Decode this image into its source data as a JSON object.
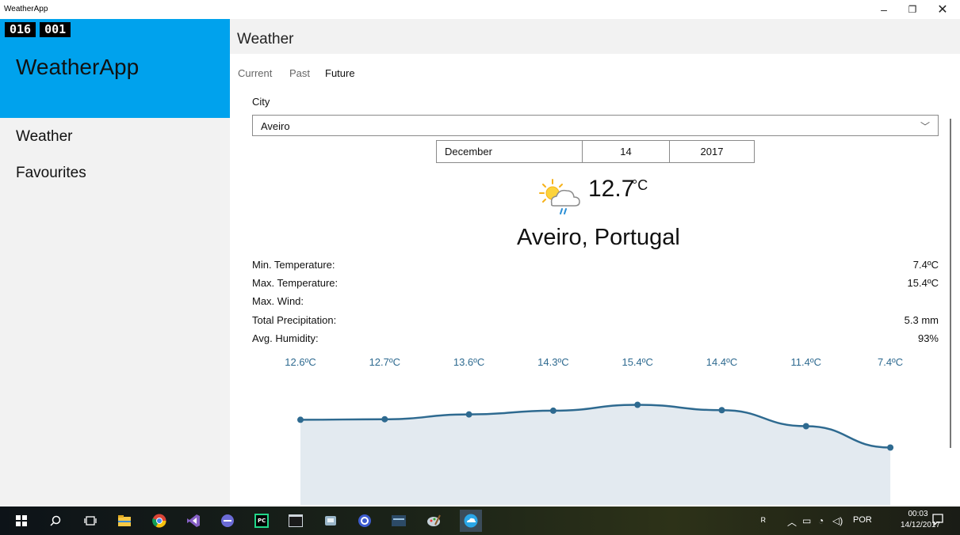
{
  "window": {
    "title": "WeatherApp"
  },
  "pane": {
    "counter": [
      "016",
      "001"
    ],
    "app_name": "WeatherApp",
    "nav": [
      "Weather",
      "Favourites"
    ]
  },
  "main": {
    "title": "Weather",
    "tabs": [
      {
        "label": "Current",
        "selected": false
      },
      {
        "label": "Past",
        "selected": false
      },
      {
        "label": "Future",
        "selected": true
      }
    ],
    "city_label": "City",
    "city_value": "Aveiro",
    "date": {
      "month": "December",
      "day": "14",
      "year": "2017"
    },
    "weather_icon": "partly-cloudy-rain-icon",
    "temperature": "12.7",
    "temperature_unit": "°C",
    "location": "Aveiro, Portugal",
    "stats": [
      {
        "label": "Min. Temperature:",
        "value": "7.4ºC"
      },
      {
        "label": "Max. Temperature:",
        "value": "15.4ºC"
      },
      {
        "label": "Max. Wind:",
        "value": ""
      },
      {
        "label": "Total Precipitation:",
        "value": "5.3 mm"
      },
      {
        "label": "Avg. Humidity:",
        "value": "93%"
      }
    ]
  },
  "chart_data": {
    "type": "area",
    "labels": [
      "12.6ºC",
      "12.7ºC",
      "13.6ºC",
      "14.3ºC",
      "15.4ºC",
      "14.4ºC",
      "11.4ºC",
      "7.4ºC"
    ],
    "values": [
      12.6,
      12.7,
      13.6,
      14.3,
      15.4,
      14.4,
      11.4,
      7.4
    ],
    "line_color": "#2e6a90",
    "fill_color": "#e3eaf0",
    "label_color": "#2e6a90"
  },
  "taskbar": {
    "tray_language": "POR",
    "clock_time": "00:03",
    "clock_date": "14/12/2017"
  },
  "colors": {
    "accent": "#00a2ed",
    "pane_bg": "#f2f2f2"
  }
}
